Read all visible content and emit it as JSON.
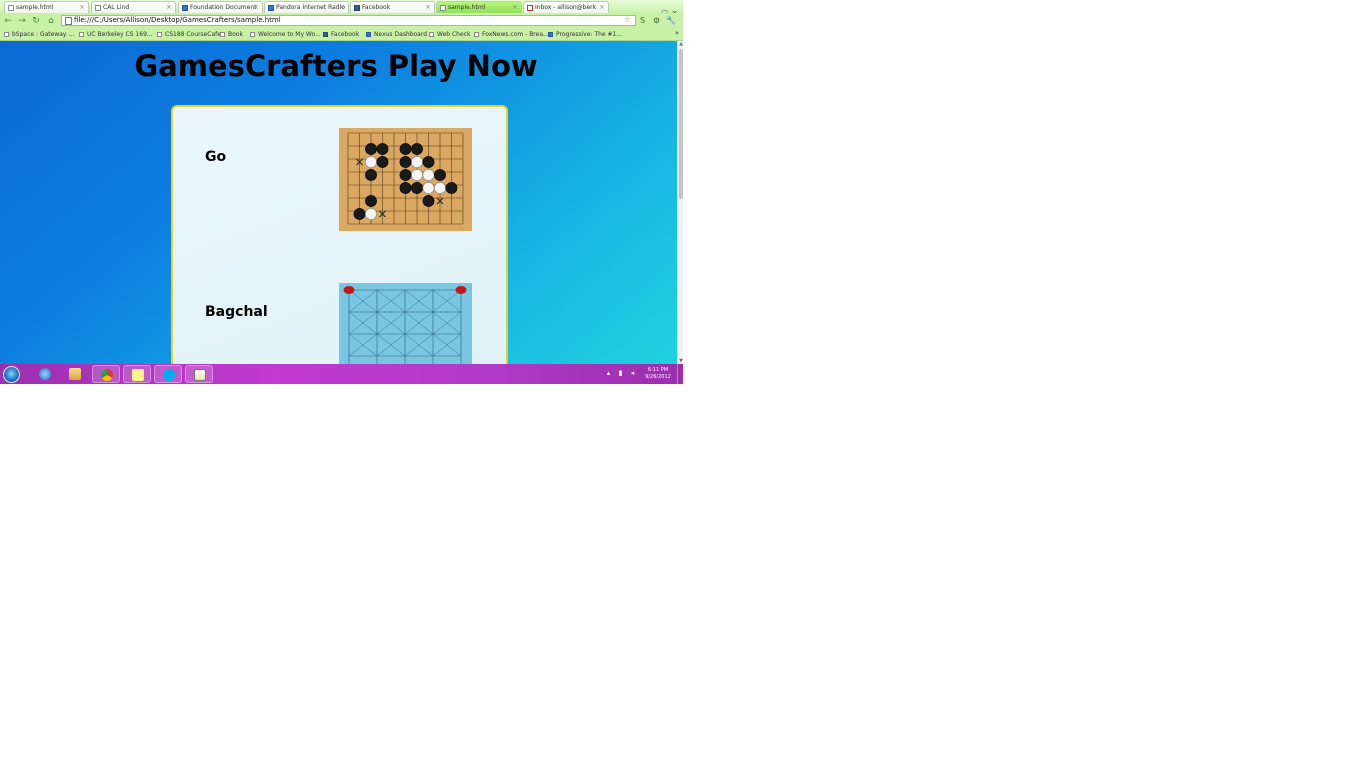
{
  "browser": {
    "tabs": [
      {
        "title": "sample.html",
        "icon": "page-icon",
        "active": false
      },
      {
        "title": "CAL Lind",
        "icon": "page-icon",
        "active": false
      },
      {
        "title": "Foundation Document",
        "icon": "p-icon",
        "active": false
      },
      {
        "title": "Pandora Internet Radio",
        "icon": "p-icon",
        "active": false
      },
      {
        "title": "Facebook",
        "icon": "facebook-icon",
        "active": false
      },
      {
        "title": "sample.html",
        "icon": "page-icon",
        "active": true
      },
      {
        "title": "Inbox - allison@berk",
        "icon": "gmail-icon",
        "active": false
      }
    ],
    "tab_close_glyph": "×",
    "window_controls": {
      "minimize": "–",
      "maximize": "□",
      "close": "×"
    },
    "nav": {
      "back": "←",
      "forward": "→",
      "reload": "↻",
      "home": "⌂"
    },
    "address": "file:///C:/Users/Allison/Desktop/GamesCrafters/sample.html",
    "bookmark_star": "☆",
    "extensions": [
      "S",
      "⚙",
      "◐",
      "🔧"
    ],
    "bookmarks": [
      {
        "label": "bSpace : Gateway ..."
      },
      {
        "label": "UC Berkeley CS 169..."
      },
      {
        "label": "CS188 CourseCafe"
      },
      {
        "label": "Book"
      },
      {
        "label": "Welcome to My Wo..."
      },
      {
        "label": "Facebook"
      },
      {
        "label": "Nexus Dashboard"
      },
      {
        "label": "Web Check"
      },
      {
        "label": "FoxNews.com - Brea..."
      },
      {
        "label": "Progressive: The #1..."
      }
    ],
    "bookmarks_more": "»"
  },
  "page": {
    "title": "GamesCrafters Play Now",
    "games": [
      {
        "name": "Go"
      },
      {
        "name": "Bagchal"
      }
    ]
  },
  "taskbar": {
    "apps": [
      {
        "name": "internet-explorer-icon",
        "open": false
      },
      {
        "name": "file-explorer-icon",
        "open": false
      },
      {
        "name": "chrome-icon",
        "open": true
      },
      {
        "name": "sticky-notes-icon",
        "open": false
      },
      {
        "name": "skype-icon",
        "open": false
      },
      {
        "name": "notepad-icon",
        "open": false
      }
    ],
    "clock_time": "6:11 PM",
    "clock_date": "9/26/2012"
  },
  "colors": {
    "tabbar": "#c9f2a8",
    "page_gradient_start": "#0a6ad2",
    "page_gradient_end": "#22d2de",
    "panel_border": "#e8d22a",
    "taskbar": "#c23ad0"
  }
}
